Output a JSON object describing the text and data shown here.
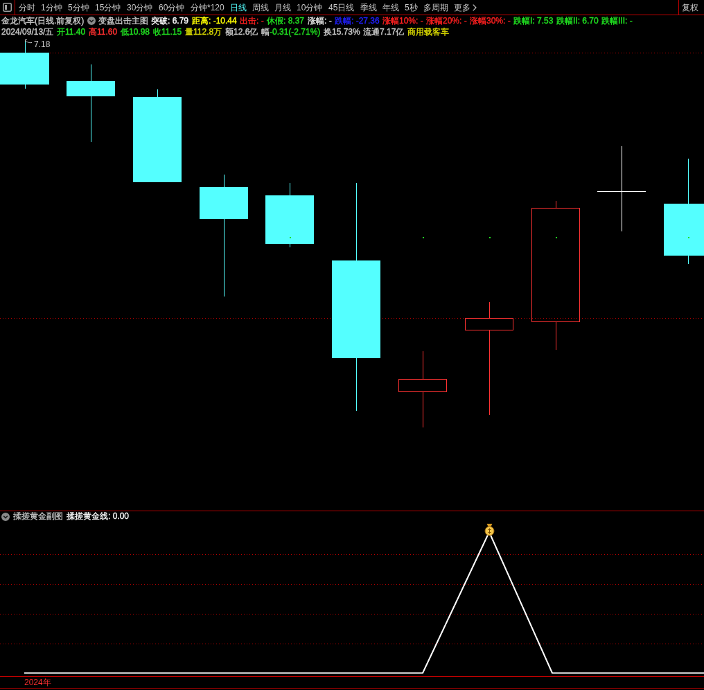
{
  "toolbar": {
    "tabs": [
      {
        "label": "分时",
        "selected": false
      },
      {
        "label": "1分钟",
        "selected": false
      },
      {
        "label": "5分钟",
        "selected": false
      },
      {
        "label": "15分钟",
        "selected": false
      },
      {
        "label": "30分钟",
        "selected": false
      },
      {
        "label": "60分钟",
        "selected": false
      },
      {
        "label": "分钟*120",
        "selected": false
      },
      {
        "label": "日线",
        "selected": true
      },
      {
        "label": "周线",
        "selected": false
      },
      {
        "label": "月线",
        "selected": false
      },
      {
        "label": "10分钟",
        "selected": false
      },
      {
        "label": "45日线",
        "selected": false
      },
      {
        "label": "季线",
        "selected": false
      },
      {
        "label": "年线",
        "selected": false
      },
      {
        "label": "5秒",
        "selected": false
      },
      {
        "label": "多周期",
        "selected": false
      }
    ],
    "more": "更多",
    "adjust_button": "复权"
  },
  "main_chart": {
    "stock_title": "金龙汽车(日线.前复权)",
    "indicator_name": "变盘出击主图",
    "indicators": [
      {
        "text": "突破: 6.79",
        "color": "#ffffff"
      },
      {
        "text": "距离: -10.44",
        "color": "#ffff00"
      },
      {
        "text": "出击: -",
        "color": "#ff2020"
      },
      {
        "text": "休假: 8.37",
        "color": "#20e020"
      },
      {
        "text": "涨幅: -",
        "color": "#e0e0e0"
      },
      {
        "text": "跌幅: -27.36",
        "color": "#2020ff"
      },
      {
        "text": "涨幅10%: -",
        "color": "#ff2020"
      },
      {
        "text": "涨幅20%: -",
        "color": "#ff2020"
      },
      {
        "text": "涨幅30%: -",
        "color": "#ff2020"
      },
      {
        "text": "跌幅I: 7.53",
        "color": "#20e020"
      },
      {
        "text": "跌幅II: 6.70",
        "color": "#20e020"
      },
      {
        "text": "跌幅III: -",
        "color": "#20e020"
      }
    ],
    "quote": [
      {
        "text": "2024/09/13/五",
        "color": "#c8c8c8"
      },
      {
        "text": "开11.40",
        "color": "#20e020"
      },
      {
        "text": "高11.60",
        "color": "#ff3030"
      },
      {
        "text": "低10.98",
        "color": "#20e020"
      },
      {
        "text": "收11.15",
        "color": "#20e020"
      },
      {
        "text": "量112.8万",
        "color": "#d8d800"
      },
      {
        "text": "额12.6亿",
        "color": "#c8c8c8"
      },
      {
        "label": "幅",
        "text": "-0.31(-2.71%)",
        "color": "#20e020"
      },
      {
        "text": "换15.73%",
        "color": "#c8c8c8"
      },
      {
        "text": "流通7.17亿",
        "color": "#c8c8c8"
      },
      {
        "text": "商用载客车",
        "color": "#d8d800"
      }
    ],
    "price_marker": "7.18"
  },
  "sub_chart": {
    "indicator_name": "揉搓黄金副图",
    "indicators": [
      {
        "text": "揉搓黄金线: 0.00",
        "color": "#ffffff"
      }
    ]
  },
  "time_axis": {
    "year": "2024年"
  }
}
